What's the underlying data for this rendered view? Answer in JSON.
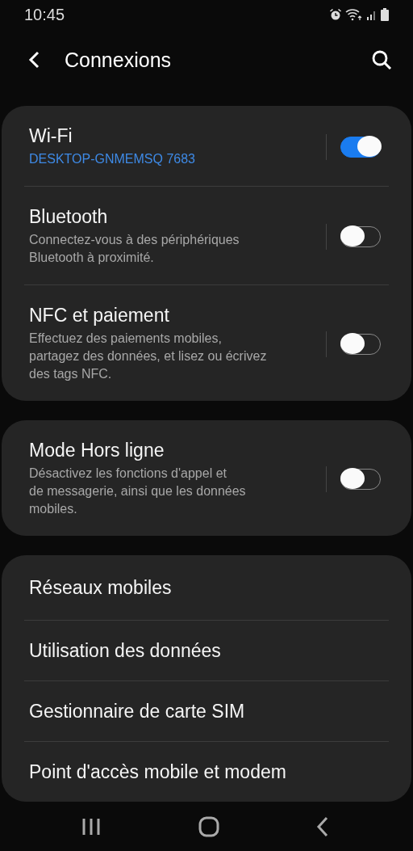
{
  "status_bar": {
    "time": "10:45"
  },
  "header": {
    "title": "Connexions"
  },
  "sections": [
    {
      "items": [
        {
          "kind": "toggle",
          "title": "Wi-Fi",
          "subtitle": "DESKTOP-GNMEMSQ 7683",
          "subtitle_accent": true,
          "on": true
        },
        {
          "kind": "toggle",
          "title": "Bluetooth",
          "subtitle": "Connectez-vous à des périphériques\nBluetooth à proximité.",
          "subtitle_accent": false,
          "on": false
        },
        {
          "kind": "toggle",
          "title": "NFC et paiement",
          "subtitle": "Effectuez des paiements mobiles,\npartagez des données, et lisez ou écrivez\ndes tags NFC.",
          "subtitle_accent": false,
          "on": false
        }
      ]
    },
    {
      "items": [
        {
          "kind": "toggle",
          "title": "Mode Hors ligne",
          "subtitle": "Désactivez les fonctions d'appel et\nde messagerie, ainsi que les données\nmobiles.",
          "subtitle_accent": false,
          "on": false
        }
      ]
    },
    {
      "items": [
        {
          "kind": "link",
          "title": "Réseaux mobiles"
        },
        {
          "kind": "link",
          "title": "Utilisation des données"
        },
        {
          "kind": "link",
          "title": "Gestionnaire de carte SIM"
        },
        {
          "kind": "link",
          "title": "Point d'accès mobile et modem"
        }
      ]
    }
  ]
}
